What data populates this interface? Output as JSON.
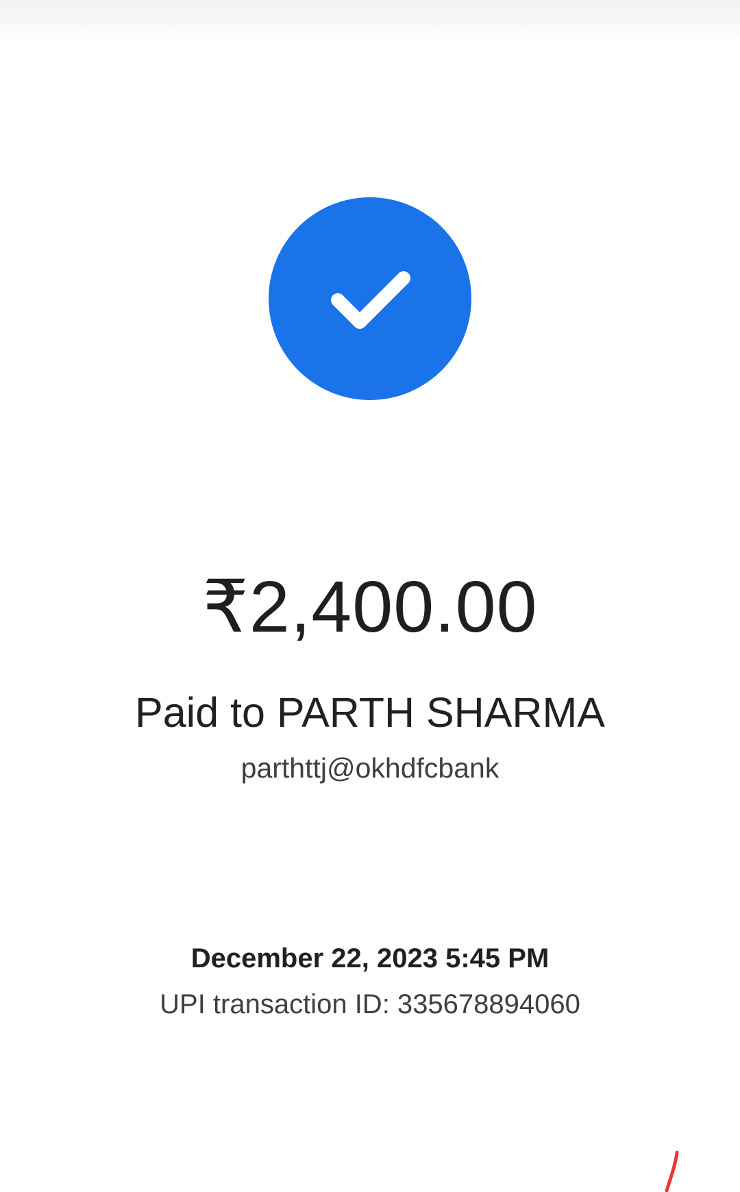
{
  "receipt": {
    "status_icon": "check-icon",
    "amount": "₹2,400.00",
    "paid_to": "Paid to PARTH SHARMA",
    "upi_handle": "parthttj@okhdfcbank",
    "datetime": "December 22, 2023 5:45 PM",
    "transaction_id_line": "UPI transaction ID: 335678894060"
  },
  "colors": {
    "accent": "#1a73e8",
    "text_primary": "#202124",
    "text_secondary": "#3c4043",
    "annotation_mark": "#e53935"
  }
}
